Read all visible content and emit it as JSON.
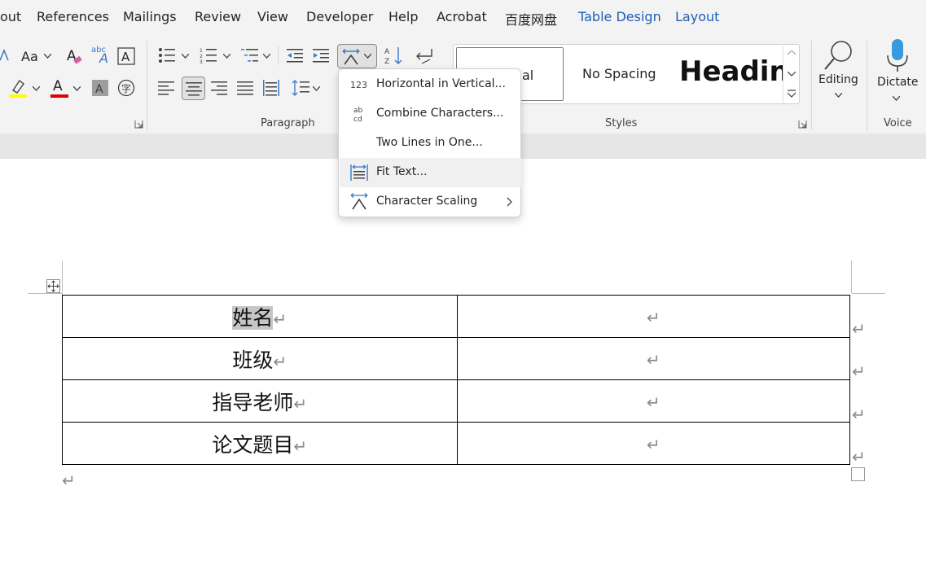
{
  "tabs": [
    {
      "label": "out"
    },
    {
      "label": "References"
    },
    {
      "label": "Mailings"
    },
    {
      "label": "Review"
    },
    {
      "label": "View"
    },
    {
      "label": "Developer"
    },
    {
      "label": "Help"
    },
    {
      "label": "Acrobat"
    },
    {
      "label": "百度网盘"
    },
    {
      "label": "Table Design"
    },
    {
      "label": "Layout"
    }
  ],
  "ribbon": {
    "paragraph_label": "Paragraph",
    "styles_label": "Styles",
    "voice_label": "Voice",
    "font_case_label": "Aa",
    "abc_label": "abc",
    "font_color_letter": "A",
    "styles": {
      "normal_partial": "al",
      "no_spacing": "No Spacing",
      "heading": "Headin"
    },
    "editing_label": "Editing",
    "dictate_label": "Dictate",
    "highlight_color": "#ffff00",
    "font_color": "#e00000"
  },
  "menu": {
    "items": [
      {
        "label": "Horizontal in Vertical...",
        "icon": "horizontal-in-vertical-icon"
      },
      {
        "label": "Combine Characters...",
        "icon": "combine-characters-icon"
      },
      {
        "label": "Two Lines in One...",
        "icon": ""
      },
      {
        "label": "Fit Text...",
        "icon": "fit-text-icon"
      },
      {
        "label": "Character Scaling",
        "icon": "character-scaling-icon"
      }
    ],
    "icon_123": "123",
    "icon_ab": "ab",
    "icon_cd": "cd"
  },
  "document": {
    "table": [
      {
        "label": "姓名"
      },
      {
        "label": "班级"
      },
      {
        "label": "指导老师"
      },
      {
        "label": "论文题目"
      }
    ],
    "paragraph_mark": "↵"
  }
}
